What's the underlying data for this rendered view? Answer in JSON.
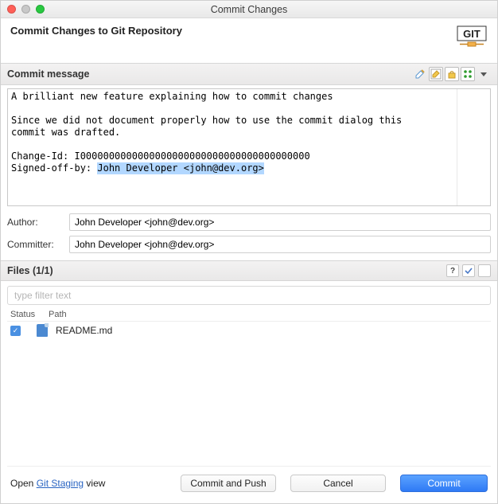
{
  "window": {
    "title": "Commit Changes"
  },
  "header": {
    "title": "Commit Changes to Git Repository",
    "logo_text": "GIT"
  },
  "commit_message": {
    "section_label": "Commit message",
    "text": "A brilliant new feature explaining how to commit changes\n\nSince we did not document properly how to use the commit dialog this\ncommit was drafted.\n\nChange-Id: I0000000000000000000000000000000000000000\nSigned-off-by: John Developer <john@dev.org>",
    "highlighted": "John Developer <john@dev.org>"
  },
  "author": {
    "label": "Author:",
    "value": "John Developer <john@dev.org>"
  },
  "committer": {
    "label": "Committer:",
    "value": "John Developer <john@dev.org>"
  },
  "files": {
    "section_label": "Files (1/1)",
    "filter_placeholder": "type filter text",
    "columns": {
      "status": "Status",
      "path": "Path"
    },
    "rows": [
      {
        "checked": true,
        "path": "README.md"
      }
    ]
  },
  "footer": {
    "open_prefix": "Open ",
    "link": "Git Staging",
    "open_suffix": " view",
    "commit_push": "Commit and Push",
    "cancel": "Cancel",
    "commit": "Commit"
  }
}
